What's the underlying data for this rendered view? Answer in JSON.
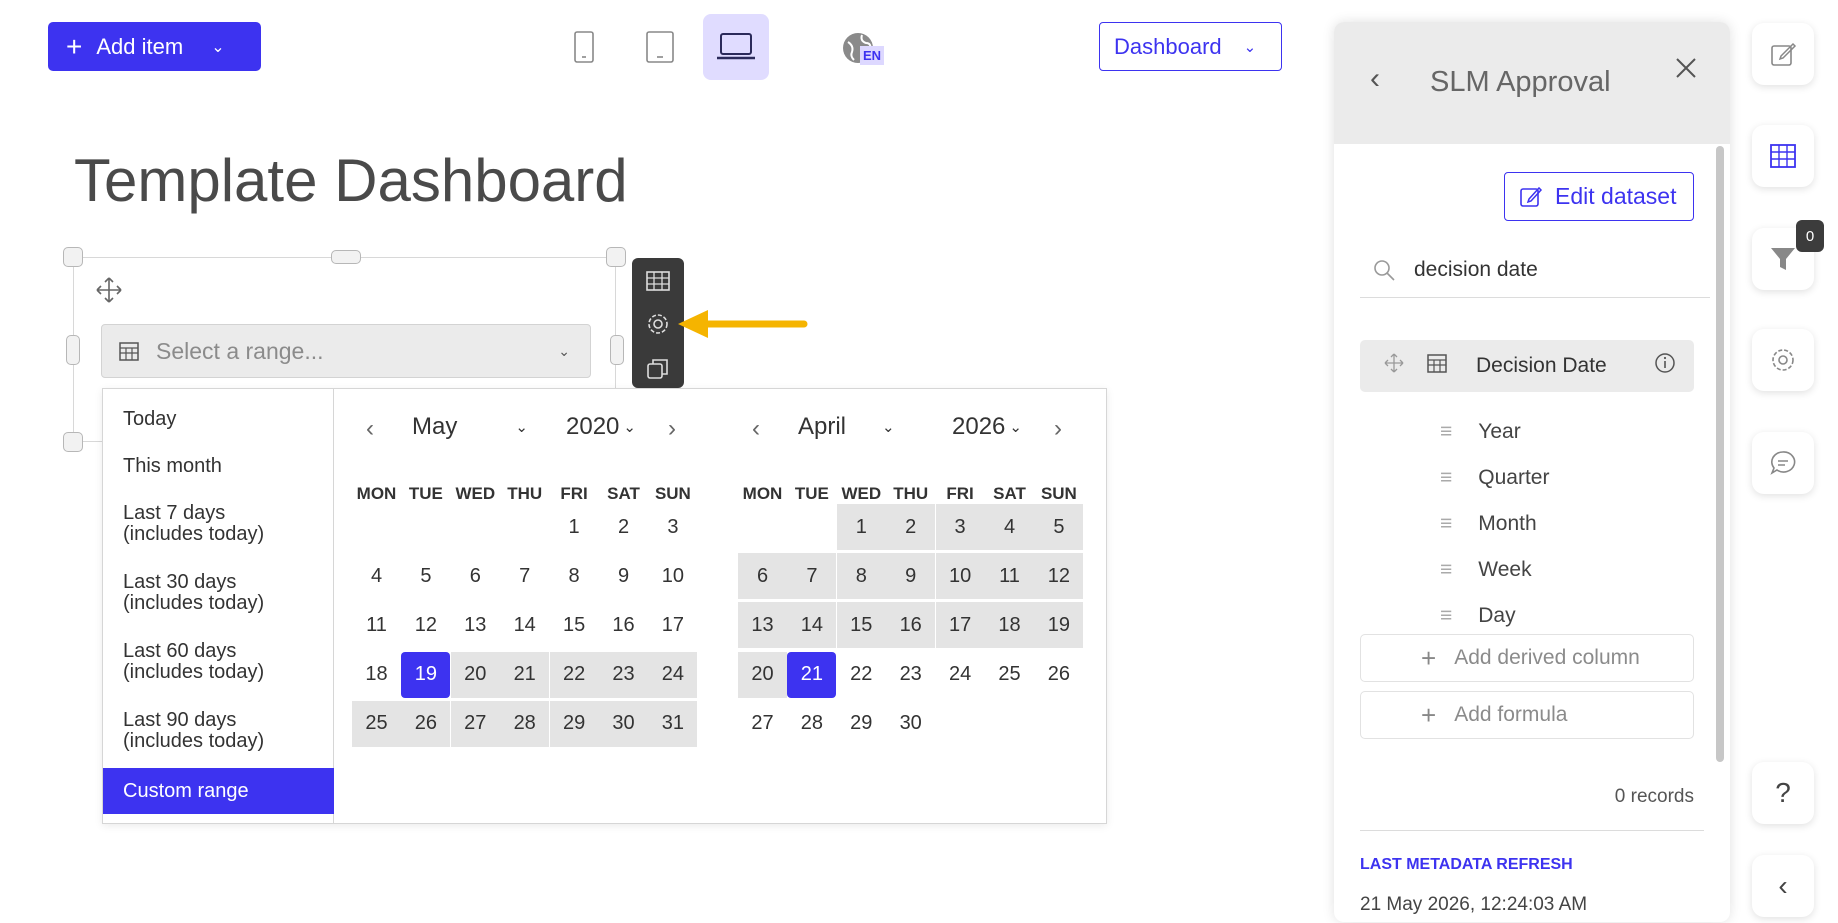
{
  "toolbar": {
    "add_item_label": "Add item",
    "language_badge": "EN",
    "view_select_label": "Dashboard"
  },
  "dashboard": {
    "title": "Template Dashboard"
  },
  "widget": {
    "range_placeholder": "Select a range..."
  },
  "presets": [
    {
      "label": "Today"
    },
    {
      "label": "This month"
    },
    {
      "label": "Last 7 days",
      "sub": "(includes today)"
    },
    {
      "label": "Last 30 days",
      "sub": "(includes today)"
    },
    {
      "label": "Last 60 days",
      "sub": "(includes today)"
    },
    {
      "label": "Last 90 days",
      "sub": "(includes today)"
    },
    {
      "label": "Custom range"
    }
  ],
  "weekdays": [
    "MON",
    "TUE",
    "WED",
    "THU",
    "FRI",
    "SAT",
    "SUN"
  ],
  "calendars": [
    {
      "month": "May",
      "year": "2020",
      "first_weekday": 4,
      "days": 31,
      "selected": 19,
      "range_from": 19,
      "range_to": 31
    },
    {
      "month": "April",
      "year": "2026",
      "first_weekday": 2,
      "days": 30,
      "selected": 21,
      "range_from": 1,
      "range_to": 21
    }
  ],
  "panel": {
    "title": "SLM Approval",
    "edit_dataset_label": "Edit dataset",
    "search_value": "decision date",
    "field_name": "Decision Date",
    "sub_fields": [
      "Year",
      "Quarter",
      "Month",
      "Week",
      "Day"
    ],
    "add_derived_label": "Add derived column",
    "add_formula_label": "Add formula",
    "records_label": "0 records",
    "metadata_label": "LAST METADATA REFRESH",
    "metadata_value": "21 May 2026, 12:24:03 AM"
  },
  "rail": {
    "filter_count": "0",
    "help_label": "?"
  },
  "colors": {
    "accent": "#3d33f0",
    "annotation_arrow": "#f5b400"
  }
}
